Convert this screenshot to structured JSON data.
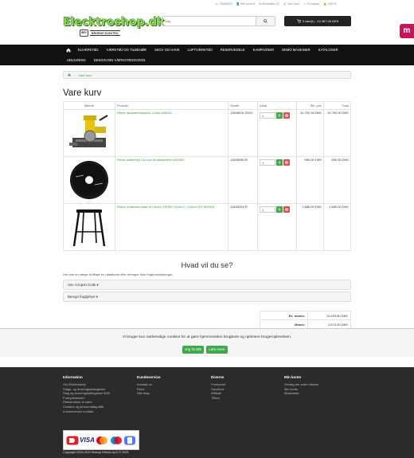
{
  "toplinks": [
    {
      "icon": "phone-icon",
      "label": "75383000"
    },
    {
      "icon": "user-icon",
      "label": "Min konto ▾"
    },
    {
      "icon": "heart-icon",
      "label": "Ønskeliste (0)"
    },
    {
      "icon": "cart-icon",
      "label": "Vare kurv"
    },
    {
      "icon": "share-icon",
      "label": "Til kassen"
    },
    {
      "icon": "lock-icon",
      "label": "GDPR"
    }
  ],
  "logo": {
    "title": "Elecktroshop.dk",
    "badge": "BEV",
    "subtitle": "BRORUP ELEKTRO"
  },
  "search": {
    "placeholder": "Søg"
  },
  "cart_button": "3 vare(r) - 13.367,00 DKK",
  "nav_row1": [
    "ELVÆRKTØJ",
    "VÆRKTØJ OG TILBEHØR",
    "SKOV OG HAVE",
    "LUFTVÆRKTØJ",
    "RESERVEDELE",
    "KAMPAGNER",
    "DEMO MASKINER",
    "KATALOGER"
  ],
  "nav_row2": [
    "UDLEJNING",
    "DESIGN DIN VÆRKSTEDSVOGN"
  ],
  "breadcrumb": {
    "current": "Vare kurv"
  },
  "page_title": "Vare kurv",
  "table": {
    "headers": [
      "Billede",
      "Produkt",
      "Model",
      "Antal",
      "Stk. pris",
      "Total"
    ],
    "rows": [
      {
        "product": "Rems rørskæremaskine Cento 845001",
        "model": "11845001 R220",
        "qty": "1",
        "unit_price": "10.792,00 DKK",
        "total": "10.792,00 DKK",
        "image": "pipe-cutter"
      },
      {
        "product": "Rems skærehjul Cu-Inox til rørafskærer 845050",
        "model": "11845050 R",
        "qty": "1",
        "unit_price": "890,00 DKK",
        "total": "890,00 DKK",
        "image": "cutting-wheel"
      },
      {
        "product": "Rems Understel stativ til Cento / REMS Turbo K / Collum RG 849315",
        "model": "11849315 R",
        "qty": "1",
        "unit_price": "1.685,00 DKK",
        "total": "1.685,00 DKK",
        "image": "stand"
      }
    ]
  },
  "next_title": "Hvad vil du se?",
  "next_text": "Her kan du vælge at tilføje en rabatkode eller beregne dine fragtomkostninger.",
  "panels": [
    "Use Coupon Code ▾",
    "Beregn fragtpriser ▾"
  ],
  "totals": [
    {
      "label": "Ex. moms:",
      "value": "10.693,60 DKK"
    },
    {
      "label": "Moms:",
      "value": "2.673,40 DKK"
    }
  ],
  "cookie": {
    "text": "Vi bruger kun nødvendige cookies for at gøre hjemmesiden brugbare og optimere brugeroplevelsen.",
    "accept": "Jeg forstår",
    "more": "Læs mere"
  },
  "footer": {
    "cols": [
      {
        "title": "Information",
        "links": [
          "Om Elektroshop",
          "Salgs- og leveringsbetingelser",
          "Salg og leveringsbetingelser B2B",
          "Fortrydelsesret",
          "Reklamation af varer",
          "Cookies og persondatapolitik",
          "Kundeservice kontakt"
        ]
      },
      {
        "title": "Kundeservice",
        "links": [
          "Kontakt os",
          "Retur",
          "Site Map"
        ]
      },
      {
        "title": "Diverse",
        "links": [
          "Producent",
          "Gavekort",
          "Affiliate",
          "Tilbud"
        ]
      },
      {
        "title": "Min konto",
        "links": [
          "Se/følg din ordre historik",
          "Min konto",
          "Ønskeliste"
        ]
      }
    ],
    "payments": [
      "dankort",
      "VISA",
      "mastercard",
      "maestro",
      "MobilePay"
    ],
    "copyright": "Copyright 2003-2024 Brørup Elektro ApS © 2025"
  },
  "colors": {
    "accent": "#3fa84a",
    "nav": "#111111",
    "remove": "#d9534f",
    "footer": "#2b2b2b",
    "side_badge": "#c2185b"
  }
}
